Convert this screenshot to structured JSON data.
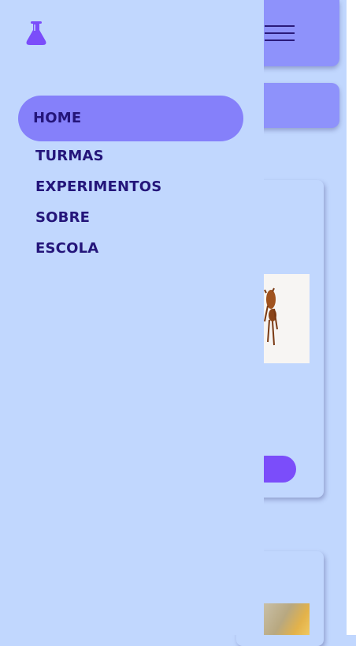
{
  "colors": {
    "drawer_background": "#c1d7fe",
    "active_item_background": "#8580fa",
    "nav_text": "#24157a",
    "header_background": "#8e92fb",
    "accent_button": "#7b4dfa"
  },
  "logo": {
    "icon": "flask-icon"
  },
  "nav": {
    "items": [
      {
        "label": "HOME",
        "active": true
      },
      {
        "label": "TURMAS",
        "active": false
      },
      {
        "label": "EXPERIMENTOS",
        "active": false
      },
      {
        "label": "SOBRE",
        "active": false
      },
      {
        "label": "ESCOLA",
        "active": false
      }
    ]
  },
  "header": {
    "menu_icon": "hamburger-menu-icon"
  }
}
